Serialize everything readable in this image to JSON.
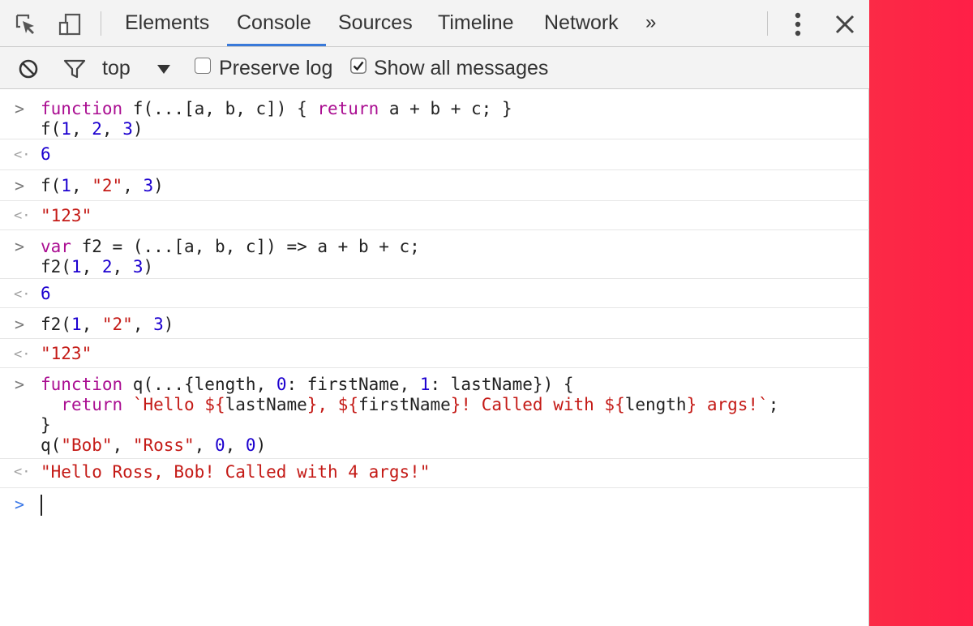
{
  "tabs": {
    "items": [
      "Elements",
      "Console",
      "Sources",
      "Timeline",
      "Network"
    ],
    "active": "Console",
    "more_label": "»"
  },
  "toolbar": {
    "context": "top",
    "preserve_log": {
      "label": "Preserve log",
      "checked": false
    },
    "show_all": {
      "label": "Show all messages",
      "checked": true
    }
  },
  "console": {
    "entries": [
      {
        "kind": "input",
        "lines": [
          "function f(...[a, b, c]) { return a + b + c; }",
          "f(1, 2, 3)"
        ]
      },
      {
        "kind": "result",
        "text": "6"
      },
      {
        "kind": "input",
        "lines": [
          "f(1, \"2\", 3)"
        ]
      },
      {
        "kind": "result",
        "text": "\"123\""
      },
      {
        "kind": "input",
        "lines": [
          "var f2 = (...[a, b, c]) => a + b + c;",
          "f2(1, 2, 3)"
        ]
      },
      {
        "kind": "result",
        "text": "6"
      },
      {
        "kind": "input",
        "lines": [
          "f2(1, \"2\", 3)"
        ]
      },
      {
        "kind": "result",
        "text": "\"123\""
      },
      {
        "kind": "input",
        "lines": [
          "function q(...{length, 0: firstName, 1: lastName}) {",
          "  return `Hello ${lastName}, ${firstName}! Called with ${length} args!`;",
          "}",
          "q(\"Bob\", \"Ross\", 0, 0)"
        ]
      },
      {
        "kind": "result",
        "text": "\"Hello Ross, Bob! Called with 4 args!\""
      }
    ],
    "input_value": ""
  },
  "colors": {
    "accent_tab_underline": "#3879d9",
    "keyword": "#aa0d91",
    "number": "#1c00cf",
    "string": "#c41a16",
    "side_strip": "#ff1f47"
  },
  "icons": [
    "inspect-element-icon",
    "device-mode-icon",
    "clear-console-icon",
    "filter-icon",
    "more-tabs-icon",
    "kebab-menu-icon",
    "close-icon"
  ]
}
